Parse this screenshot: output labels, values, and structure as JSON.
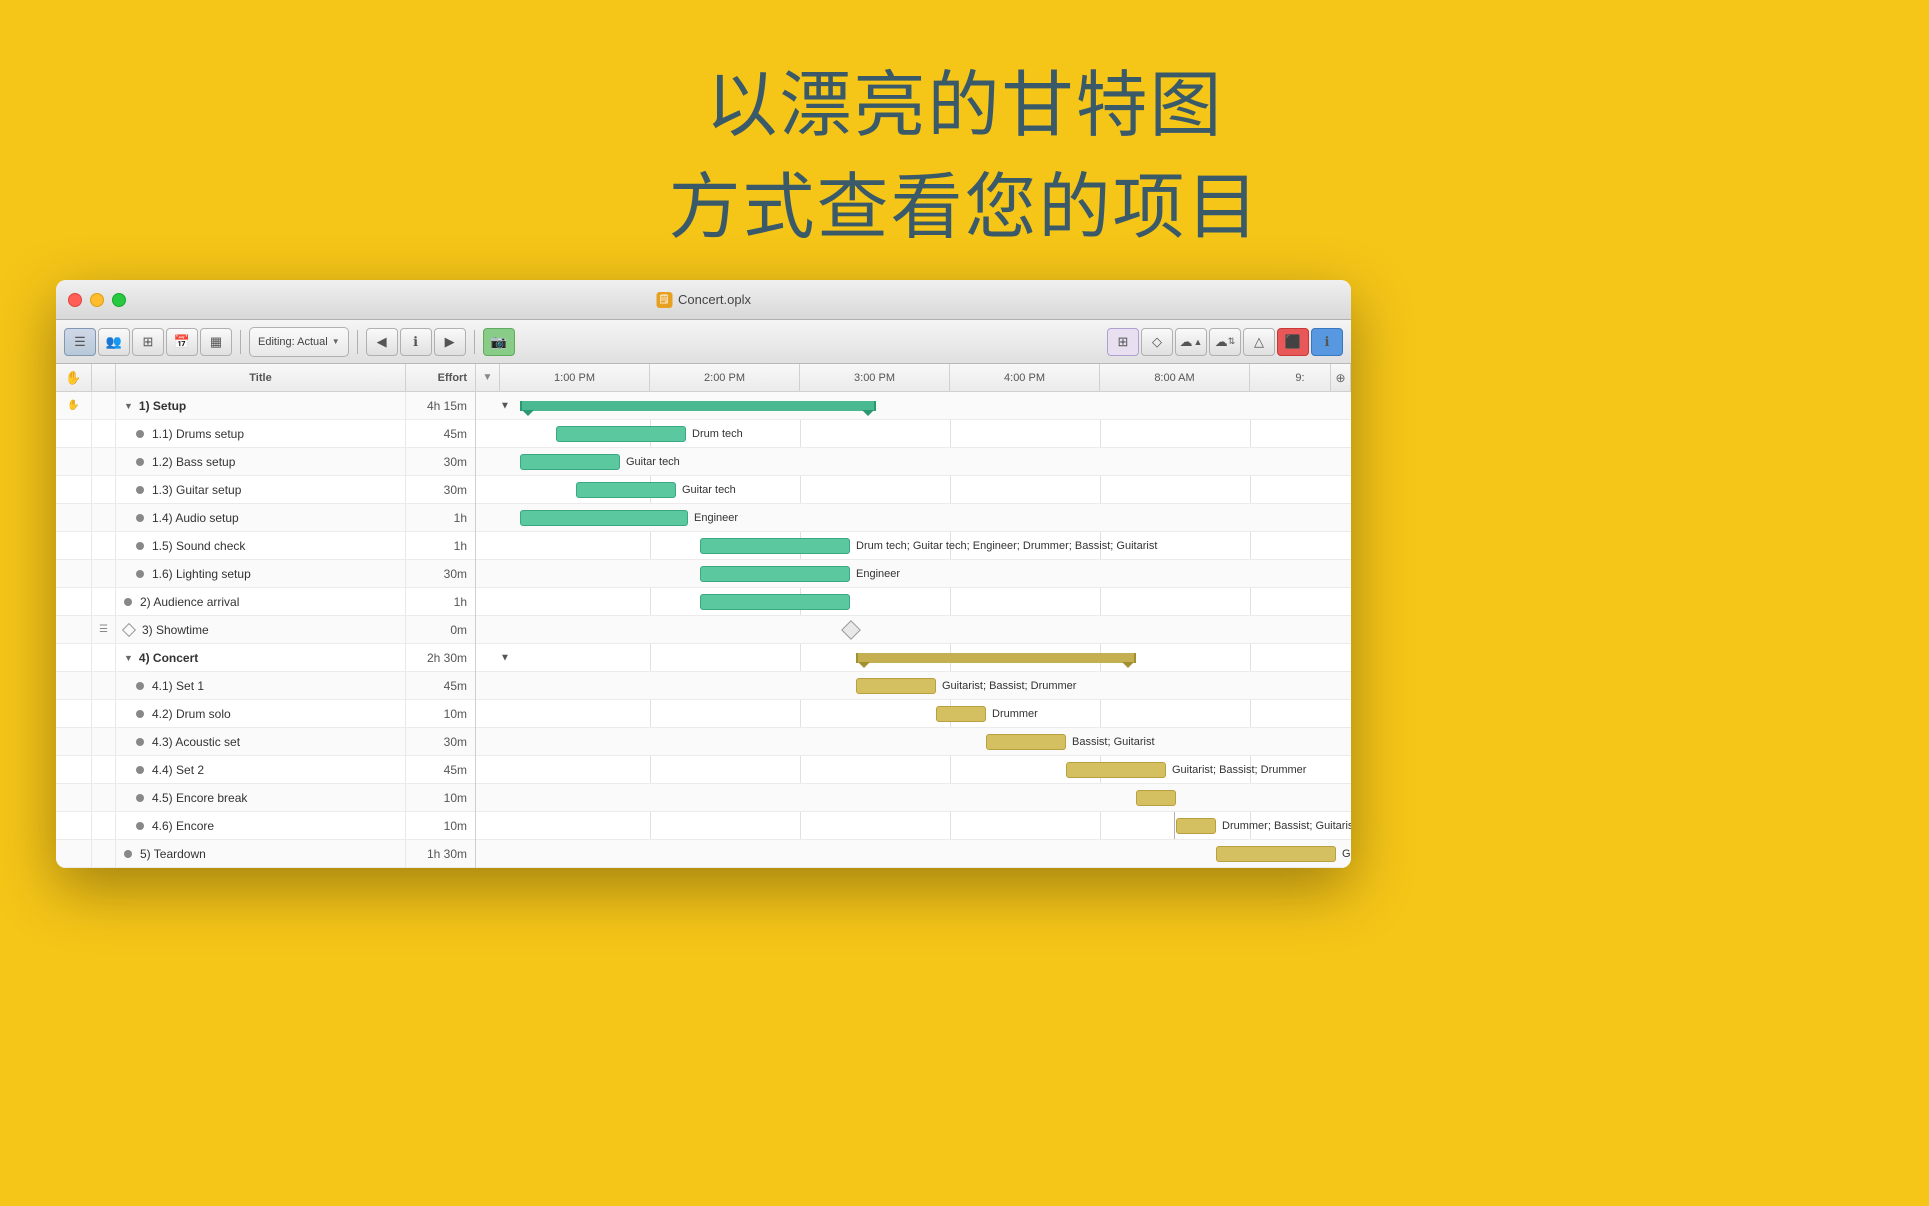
{
  "hero": {
    "line1": "以漂亮的甘特图",
    "line2": "方式查看您的项目"
  },
  "window": {
    "title": "Concert.oplx",
    "title_icon": "📋"
  },
  "toolbar": {
    "editing_label": "Editing: Actual",
    "buttons": [
      "list-view",
      "people-view",
      "grid-view",
      "calendar-view",
      "fill-view",
      "editing-dropdown",
      "nav-prev",
      "info-btn",
      "nav-next",
      "screenshot",
      "table-btn",
      "diamond-btn",
      "cloud-up",
      "cloud-sync",
      "triangle-btn",
      "stop-btn",
      "info-circle"
    ]
  },
  "columns": {
    "title": "Title",
    "effort": "Effort"
  },
  "tasks": [
    {
      "id": "1",
      "level": 1,
      "type": "group",
      "collapsed": false,
      "name": "1)  Setup",
      "effort": "4h 15m",
      "has_notes": false
    },
    {
      "id": "1.1",
      "level": 2,
      "type": "task",
      "name": "1.1)  Drums setup",
      "effort": "45m",
      "has_notes": false
    },
    {
      "id": "1.2",
      "level": 2,
      "type": "task",
      "name": "1.2)  Bass setup",
      "effort": "30m",
      "has_notes": false
    },
    {
      "id": "1.3",
      "level": 2,
      "type": "task",
      "name": "1.3)  Guitar setup",
      "effort": "30m",
      "has_notes": false
    },
    {
      "id": "1.4",
      "level": 2,
      "type": "task",
      "name": "1.4)  Audio setup",
      "effort": "1h",
      "has_notes": false
    },
    {
      "id": "1.5",
      "level": 2,
      "type": "task",
      "name": "1.5)  Sound check",
      "effort": "1h",
      "has_notes": false
    },
    {
      "id": "1.6",
      "level": 2,
      "type": "task",
      "name": "1.6)  Lighting setup",
      "effort": "30m",
      "has_notes": false
    },
    {
      "id": "2",
      "level": 1,
      "type": "task",
      "name": "2)  Audience arrival",
      "effort": "1h",
      "has_notes": false
    },
    {
      "id": "3",
      "level": 1,
      "type": "milestone",
      "name": "3)  Showtime",
      "effort": "0m",
      "has_notes": true
    },
    {
      "id": "4",
      "level": 1,
      "type": "group",
      "collapsed": false,
      "name": "4)  Concert",
      "effort": "2h 30m",
      "has_notes": false
    },
    {
      "id": "4.1",
      "level": 2,
      "type": "task",
      "name": "4.1)  Set 1",
      "effort": "45m",
      "has_notes": false
    },
    {
      "id": "4.2",
      "level": 2,
      "type": "task",
      "name": "4.2)  Drum solo",
      "effort": "10m",
      "has_notes": false
    },
    {
      "id": "4.3",
      "level": 2,
      "type": "task",
      "name": "4.3)  Acoustic set",
      "effort": "30m",
      "has_notes": false
    },
    {
      "id": "4.4",
      "level": 2,
      "type": "task",
      "name": "4.4)  Set 2",
      "effort": "45m",
      "has_notes": false
    },
    {
      "id": "4.5",
      "level": 2,
      "type": "task",
      "name": "4.5)  Encore break",
      "effort": "10m",
      "has_notes": false
    },
    {
      "id": "4.6",
      "level": 2,
      "type": "task",
      "name": "4.6)  Encore",
      "effort": "10m",
      "has_notes": false
    },
    {
      "id": "5",
      "level": 1,
      "type": "task",
      "name": "5)  Teardown",
      "effort": "1h 30m",
      "has_notes": false
    }
  ],
  "gantt_times": [
    "1:00 PM",
    "2:00 PM",
    "3:00 PM",
    "4:00 PM",
    "8:00 AM",
    "9:"
  ],
  "gantt_labels": {
    "row_11": "Drum tech",
    "row_12": "Guitar tech",
    "row_13": "Guitar tech",
    "row_14": "Engineer",
    "row_15": "Drum tech; Guitar tech; Engineer; Drummer; Bassist; Guitarist",
    "row_16": "Engineer",
    "row_41": "Guitarist; Bassist; Drummer",
    "row_42": "Drummer",
    "row_43": "Bassist; Guitarist",
    "row_44": "Guitarist; Bassist; Drummer",
    "row_46": "Drummer; Bassist; Guitarist",
    "row_5": "Guitar tech; Engineer; Drum tech"
  },
  "colors": {
    "background": "#F5C518",
    "heading": "#3a5a6a",
    "teal_bar": "#5cc8a0",
    "yellow_bar": "#d4c060",
    "window_bg": "#e8e8e8"
  }
}
